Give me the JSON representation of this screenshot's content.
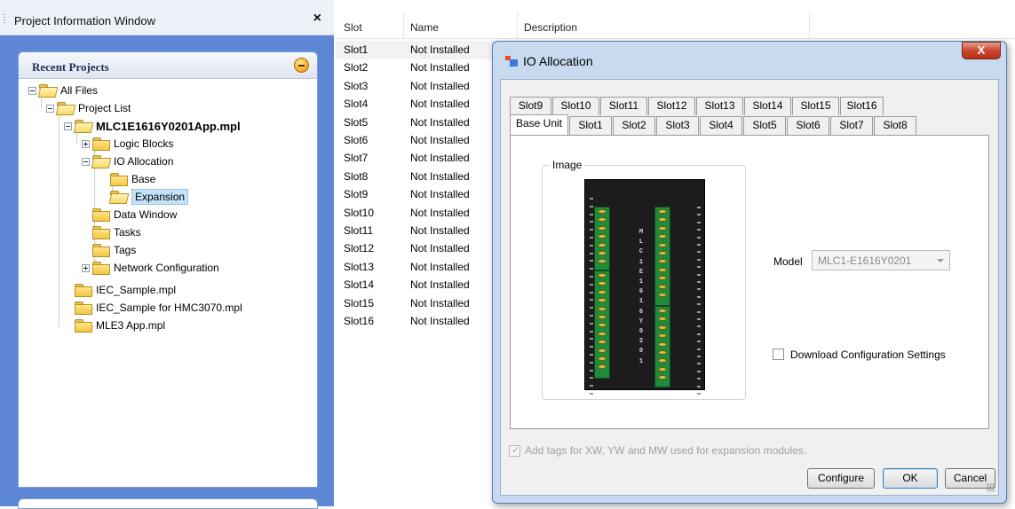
{
  "left_panel": {
    "title": "Project Information Window",
    "close_glyph": "×",
    "recent_title": "Recent Projects",
    "tree": {
      "all_files": "All Files",
      "project_list": "Project List",
      "app_project": "MLC1E1616Y0201App.mpl",
      "logic_blocks": "Logic Blocks",
      "io_allocation": "IO Allocation",
      "base": "Base",
      "expansion": "Expansion",
      "data_window": "Data Window",
      "tasks": "Tasks",
      "tags": "Tags",
      "network_configuration": "Network Configuration",
      "iec_sample": "IEC_Sample.mpl",
      "iec_sample_hmc": "IEC_Sample for HMC3070.mpl",
      "mle3_app": "MLE3 App.mpl"
    }
  },
  "slot_table": {
    "columns": [
      "Slot",
      "Name",
      "Description"
    ],
    "rows": [
      {
        "slot": "Slot1",
        "name": "Not Installed"
      },
      {
        "slot": "Slot2",
        "name": "Not Installed"
      },
      {
        "slot": "Slot3",
        "name": "Not Installed"
      },
      {
        "slot": "Slot4",
        "name": "Not Installed"
      },
      {
        "slot": "Slot5",
        "name": "Not Installed"
      },
      {
        "slot": "Slot6",
        "name": "Not Installed"
      },
      {
        "slot": "Slot7",
        "name": "Not Installed"
      },
      {
        "slot": "Slot8",
        "name": "Not Installed"
      },
      {
        "slot": "Slot9",
        "name": "Not Installed"
      },
      {
        "slot": "Slot10",
        "name": "Not Installed"
      },
      {
        "slot": "Slot11",
        "name": "Not Installed"
      },
      {
        "slot": "Slot12",
        "name": "Not Installed"
      },
      {
        "slot": "Slot13",
        "name": "Not Installed"
      },
      {
        "slot": "Slot14",
        "name": "Not Installed"
      },
      {
        "slot": "Slot15",
        "name": "Not Installed"
      },
      {
        "slot": "Slot16",
        "name": "Not Installed"
      }
    ]
  },
  "dialog": {
    "title": "IO Allocation",
    "close_glyph": "X",
    "tabs_row1": [
      "Slot9",
      "Slot10",
      "Slot11",
      "Slot12",
      "Slot13",
      "Slot14",
      "Slot15",
      "Slot16"
    ],
    "tabs_row2": [
      "Base Unit",
      "Slot1",
      "Slot2",
      "Slot3",
      "Slot4",
      "Slot5",
      "Slot6",
      "Slot7",
      "Slot8"
    ],
    "active_tab": "Base Unit",
    "image_group_label": "Image",
    "device_text": "MLC1 E1616Y0201",
    "model_label": "Model",
    "model_value": "MLC1-E1616Y0201",
    "download_label": "Download Configuration Settings",
    "download_checked": false,
    "tags_label": "Add tags for XW, YW and MW used for expansion modules.",
    "tags_checked": true,
    "buttons": {
      "configure": "Configure",
      "ok": "OK",
      "cancel": "Cancel"
    }
  }
}
